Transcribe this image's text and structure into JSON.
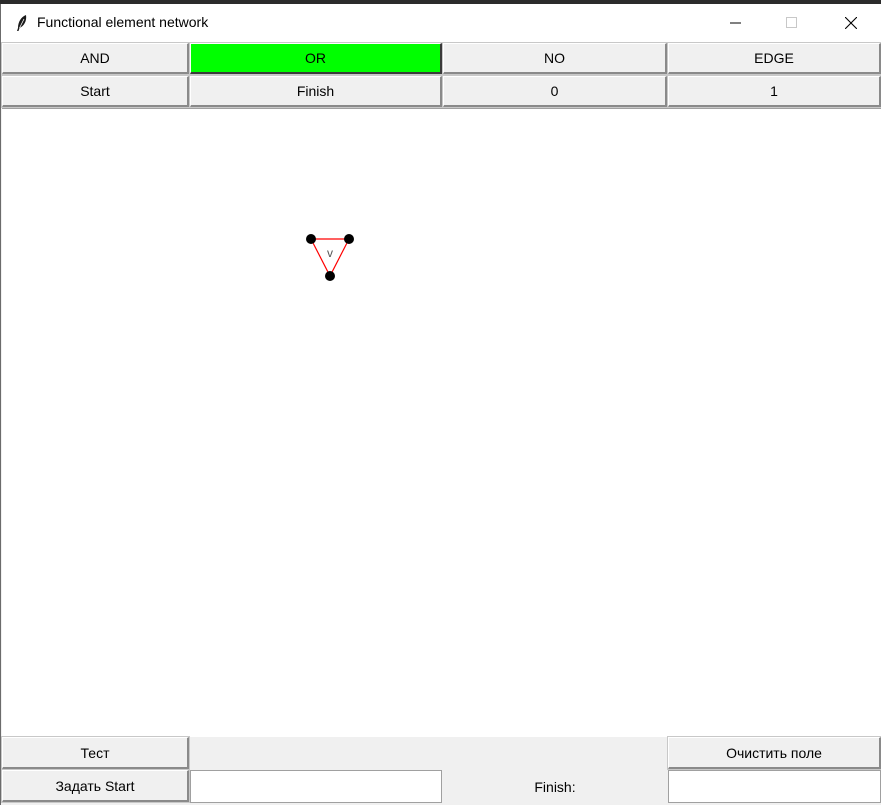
{
  "window": {
    "title": "Functional element network",
    "icon": "feather-icon"
  },
  "toolbar_row1": [
    {
      "label": "AND",
      "active": false
    },
    {
      "label": "OR",
      "active": true
    },
    {
      "label": "NO",
      "active": false
    },
    {
      "label": "EDGE",
      "active": false
    }
  ],
  "toolbar_row2": [
    {
      "label": "Start"
    },
    {
      "label": "Finish"
    },
    {
      "label": "0"
    },
    {
      "label": "1"
    }
  ],
  "canvas": {
    "element_symbol": "v",
    "colors": {
      "triangle": "#ff0000",
      "node": "#000000"
    }
  },
  "bottom": {
    "test_label": "Тест",
    "clear_label": "Очистить поле",
    "set_start_label": "Задать Start",
    "start_value": "",
    "finish_label": "Finish:",
    "finish_value": ""
  },
  "colors": {
    "active_button": "#00ff00",
    "background": "#f0f0f0"
  }
}
